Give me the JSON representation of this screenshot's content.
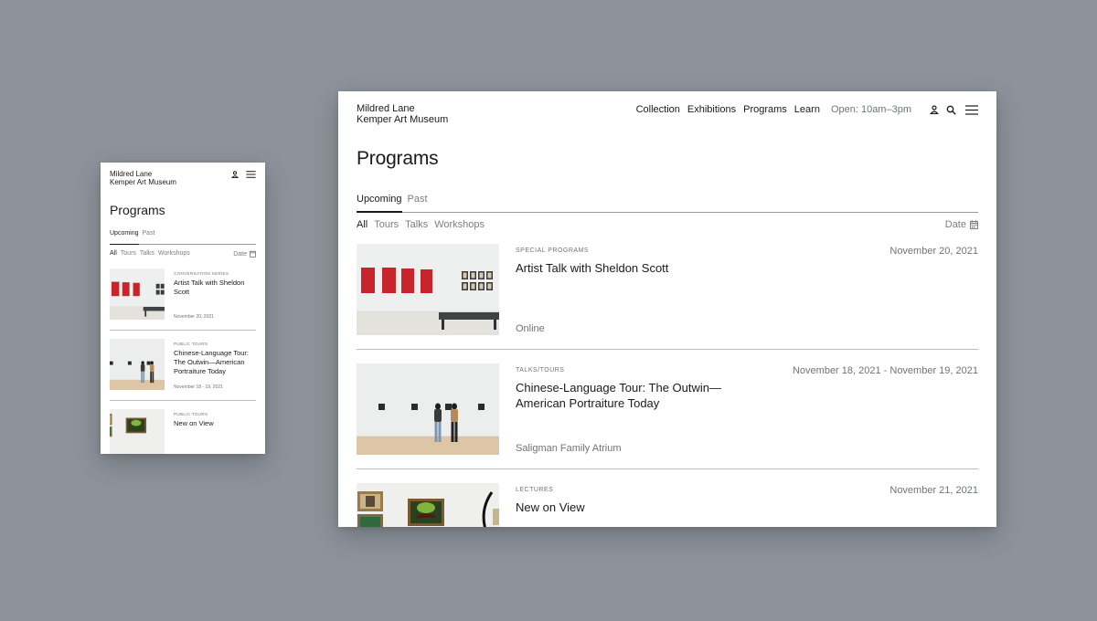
{
  "site": {
    "logo_line1": "Mildred Lane",
    "logo_line2": "Kemper Art Museum"
  },
  "nav": {
    "items": [
      "Collection",
      "Exhibitions",
      "Programs",
      "Learn"
    ],
    "hours": "Open: 10am–3pm"
  },
  "page": {
    "title": "Programs",
    "tabs": [
      {
        "label": "Upcoming",
        "active": true
      },
      {
        "label": "Past",
        "active": false
      }
    ],
    "filters": [
      {
        "label": "All",
        "active": true
      },
      {
        "label": "Tours",
        "active": false
      },
      {
        "label": "Talks",
        "active": false
      },
      {
        "label": "Workshops",
        "active": false
      }
    ],
    "sort_label": "Date"
  },
  "desktop_programs": [
    {
      "category": "Special Programs",
      "title": "Artist Talk with Sheldon Scott",
      "date": "November 20, 2021",
      "location": "Online"
    },
    {
      "category": "Talks/Tours",
      "title": "Chinese-Language Tour: The Outwin—American Portraiture Today",
      "date": "November 18, 2021 - November 19, 2021",
      "location": "Saligman Family Atrium"
    },
    {
      "category": "Lectures",
      "title": "New on View",
      "date": "November 21, 2021",
      "location": ""
    }
  ],
  "mobile_programs": [
    {
      "category": "Conversation Series",
      "title": "Artist Talk with Sheldon Scott",
      "date": "November 20, 2021"
    },
    {
      "category": "Public Tours",
      "title": "Chinese-Language Tour: The Outwin—American Portraiture Today",
      "date": "November 18 - 19, 2021"
    },
    {
      "category": "Public Tours",
      "title": "New on View",
      "date": ""
    }
  ],
  "icons": {
    "account": "user-icon",
    "search": "search-icon",
    "menu": "menu-icon",
    "calendar": "calendar-icon"
  },
  "colors": {
    "background": "#8d939b",
    "accent_red": "#c8242c",
    "text": "#1b1b1b",
    "muted": "#6f7378"
  }
}
